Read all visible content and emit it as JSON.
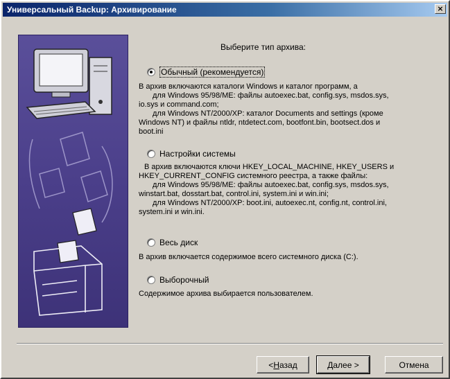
{
  "window": {
    "title": "Универсальный Backup: Архивирование"
  },
  "heading": "Выберите тип архива:",
  "options": [
    {
      "label": "Обычный (рекомендуется)",
      "checked": true,
      "desc": [
        "В архив включаются каталоги Windows и каталог программ, а",
        "    для Windows 95/98/ME: файлы autoexec.bat, config.sys, msdos.sys,",
        "io.sys и command.com;",
        "    для Windows NT/2000/XP: каталог Documents and settings (кроме",
        "Windows NT) и файлы ntldr, ntdetect.com, bootfont.bin, bootsect.dos и",
        "boot.ini"
      ]
    },
    {
      "label": "Настройки системы",
      "checked": false,
      "desc": [
        "В архив включаются ключи HKEY_LOCAL_MACHINE, HKEY_USERS и",
        "HKEY_CURRENT_CONFIG системного реестра, а также файлы:",
        "    для Windows 95/98/ME: файлы autoexec.bat, config.sys, msdos.sys,",
        "winstart.bat, dosstart.bat, control.ini, system.ini и win.ini;",
        "    для Windows NT/2000/XP: boot.ini, autoexec.nt, config.nt, control.ini,",
        "system.ini и win.ini."
      ]
    },
    {
      "label": "Весь диск",
      "checked": false,
      "desc": [
        "В архив включается содержимое всего системного диска (C:)."
      ]
    },
    {
      "label": "Выборочный",
      "checked": false,
      "desc": [
        "Содержимое архива выбирается пользователем."
      ]
    }
  ],
  "buttons": {
    "back_prefix": "< ",
    "back_mnemonic": "Н",
    "back_rest": "азад",
    "next": "Далее >",
    "cancel": "Отмена"
  },
  "icons": {
    "close": "×"
  }
}
